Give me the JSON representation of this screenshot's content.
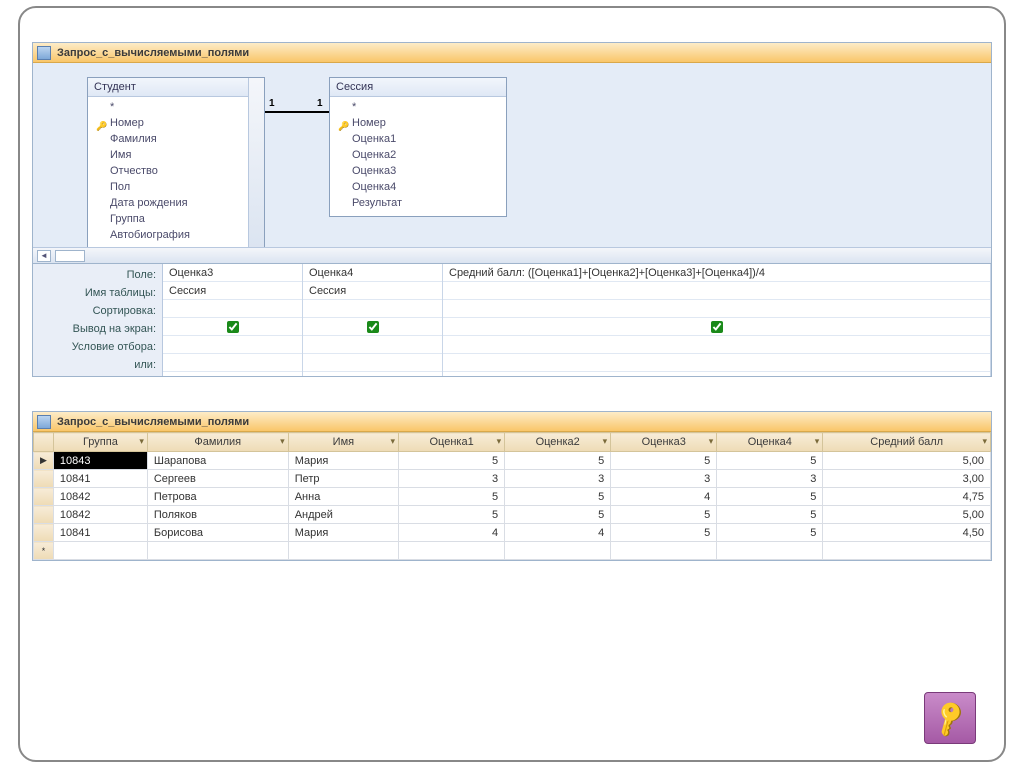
{
  "designer": {
    "title": "Запрос_с_вычисляемыми_полями",
    "relationship": {
      "left_card": "1",
      "right_card": "1"
    },
    "tables": [
      {
        "name": "Студент",
        "fields": [
          {
            "label": "*",
            "pk": false
          },
          {
            "label": "Номер",
            "pk": true
          },
          {
            "label": "Фамилия",
            "pk": false
          },
          {
            "label": "Имя",
            "pk": false
          },
          {
            "label": "Отчество",
            "pk": false
          },
          {
            "label": "Пол",
            "pk": false
          },
          {
            "label": "Дата рождения",
            "pk": false
          },
          {
            "label": "Группа",
            "pk": false
          },
          {
            "label": "Автобиография",
            "pk": false
          }
        ]
      },
      {
        "name": "Сессия",
        "fields": [
          {
            "label": "*",
            "pk": false
          },
          {
            "label": "Номер",
            "pk": true
          },
          {
            "label": "Оценка1",
            "pk": false
          },
          {
            "label": "Оценка2",
            "pk": false
          },
          {
            "label": "Оценка3",
            "pk": false
          },
          {
            "label": "Оценка4",
            "pk": false
          },
          {
            "label": "Результат",
            "pk": false
          }
        ]
      }
    ],
    "grid_labels": {
      "field": "Поле:",
      "table": "Имя таблицы:",
      "sort": "Сортировка:",
      "show": "Вывод на экран:",
      "criteria": "Условие отбора:",
      "or": "или:"
    },
    "grid_cols": [
      {
        "field": "Оценка3",
        "table": "Сессия",
        "show": true
      },
      {
        "field": "Оценка4",
        "table": "Сессия",
        "show": true
      },
      {
        "field": "Средний балл: ([Оценка1]+[Оценка2]+[Оценка3]+[Оценка4])/4",
        "table": "",
        "show": true
      }
    ]
  },
  "result": {
    "title": "Запрос_с_вычисляемыми_полями",
    "columns": [
      "Группа",
      "Фамилия",
      "Имя",
      "Оценка1",
      "Оценка2",
      "Оценка3",
      "Оценка4",
      "Средний балл"
    ],
    "rows": [
      {
        "group": "10843",
        "fam": "Шарапова",
        "name": "Мария",
        "o1": "5",
        "o2": "5",
        "o3": "5",
        "o4": "5",
        "avg": "5,00",
        "selected": true
      },
      {
        "group": "10841",
        "fam": "Сергеев",
        "name": "Петр",
        "o1": "3",
        "o2": "3",
        "o3": "3",
        "o4": "3",
        "avg": "3,00",
        "selected": false
      },
      {
        "group": "10842",
        "fam": "Петрова",
        "name": "Анна",
        "o1": "5",
        "o2": "5",
        "o3": "4",
        "o4": "5",
        "avg": "4,75",
        "selected": false
      },
      {
        "group": "10842",
        "fam": "Поляков",
        "name": "Андрей",
        "o1": "5",
        "o2": "5",
        "o3": "5",
        "o4": "5",
        "avg": "5,00",
        "selected": false
      },
      {
        "group": "10841",
        "fam": "Борисова",
        "name": "Мария",
        "o1": "4",
        "o2": "4",
        "o3": "5",
        "o4": "5",
        "avg": "4,50",
        "selected": false
      }
    ],
    "new_row_marker": "*"
  }
}
